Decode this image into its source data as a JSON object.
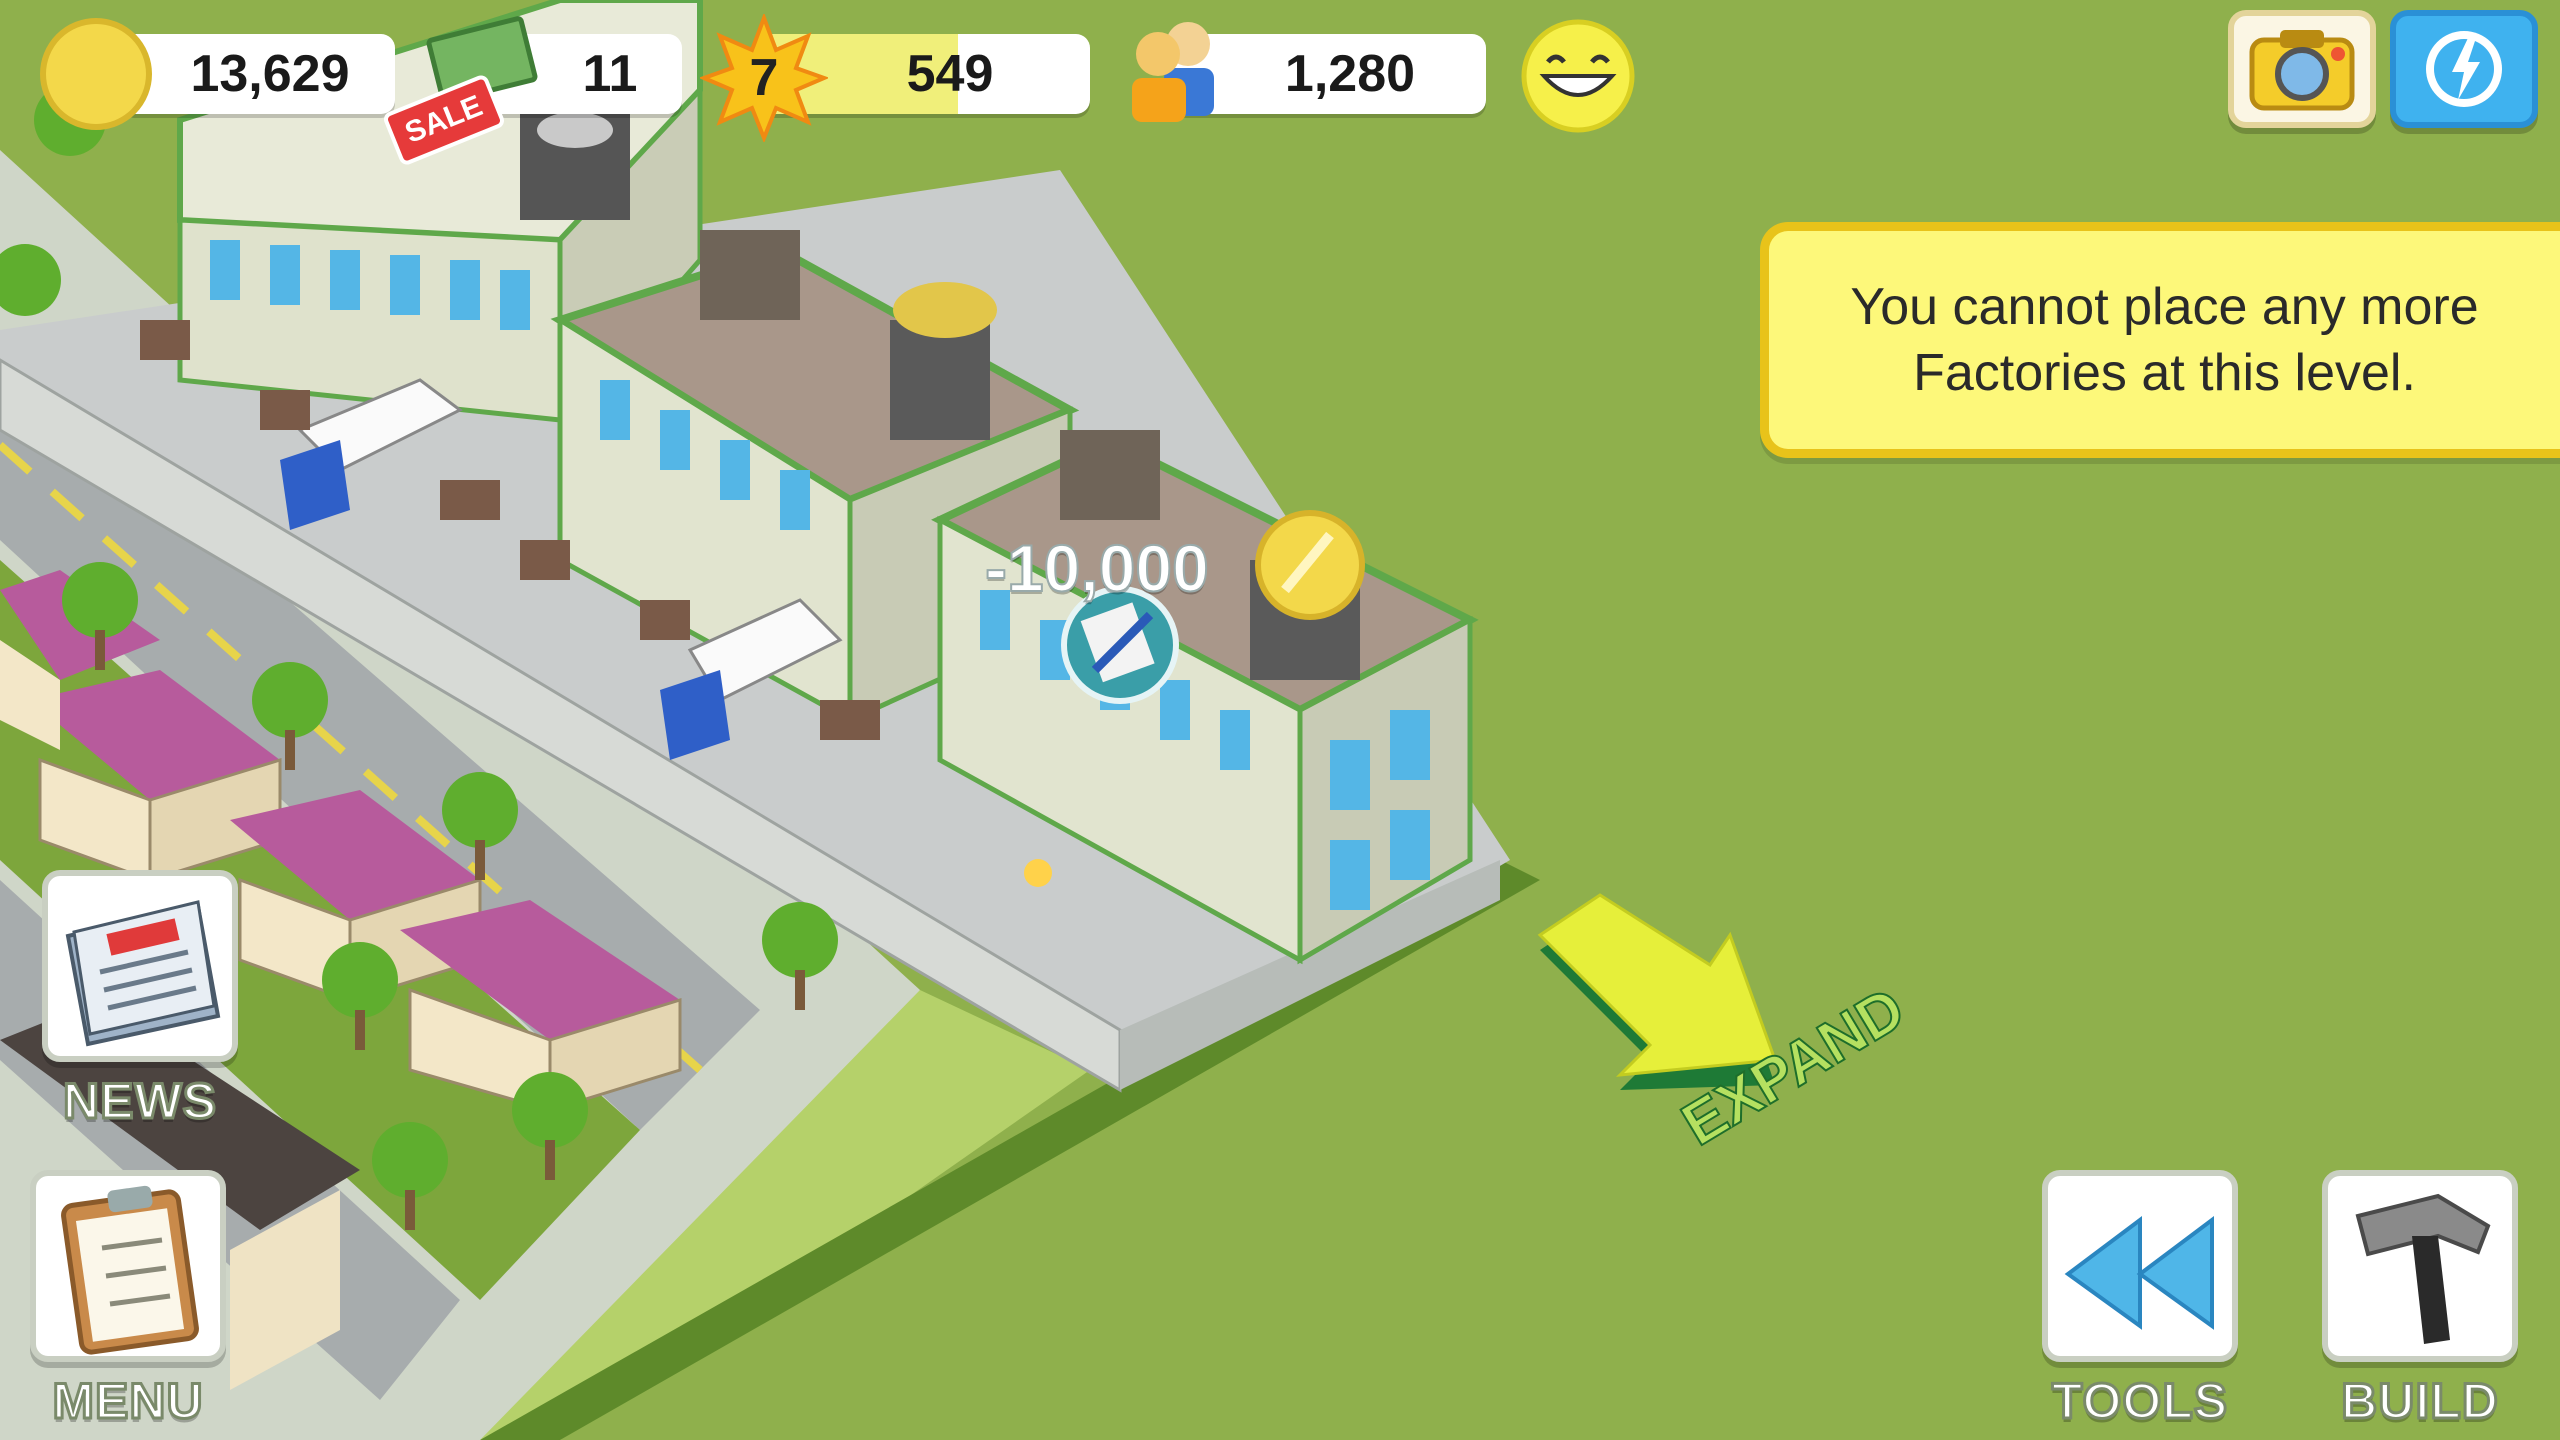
{
  "hud": {
    "coins": "13,629",
    "cash": "11",
    "level": "7",
    "xp": "549",
    "xp_progress": 0.6,
    "population": "1,280",
    "happiness_icon": "smiley-icon",
    "sale_badge": "SALE"
  },
  "notice": {
    "line1": "You cannot place any more",
    "line2": "Factories at this level."
  },
  "map": {
    "cost_popup": "-10,000",
    "expand_label": "EXPAND"
  },
  "buttons": {
    "news": "NEWS",
    "menu": "MENU",
    "tools": "TOOLS",
    "build": "BUILD"
  },
  "colors": {
    "grass": "#8fb04c",
    "notice_bg": "#fdf87a",
    "notice_border": "#e8c31a",
    "xp_fill": "#f0ef7a",
    "roof_houses": "#b75b9c",
    "arrow": "#e6ef3a"
  }
}
